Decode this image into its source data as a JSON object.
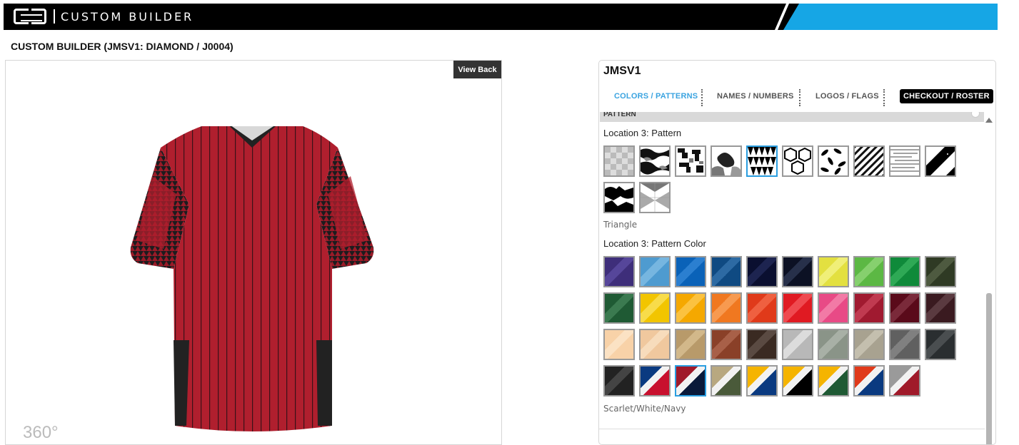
{
  "header": {
    "brand_mark": "CB",
    "brand_name": "CUSTOM BUILDER"
  },
  "page_title": "CUSTOM BUILDER (JMSV1: DIAMOND / J0004)",
  "preview": {
    "view_back_label": "View Back",
    "rotate_label": "360°"
  },
  "panel": {
    "product_code": "JMSV1",
    "tabs": [
      {
        "label": "COLORS / PATTERNS",
        "active": true
      },
      {
        "label": "NAMES / NUMBERS",
        "active": false
      },
      {
        "label": "LOGOS / FLAGS",
        "active": false
      },
      {
        "label": "CHECKOUT / ROSTER",
        "active": false
      }
    ],
    "section_header": "PATTERN",
    "pattern_label": "Location 3: Pattern",
    "patterns": [
      {
        "name": "checker",
        "selected": false
      },
      {
        "name": "camo",
        "selected": false
      },
      {
        "name": "digital-camo",
        "selected": false
      },
      {
        "name": "splatter",
        "selected": false
      },
      {
        "name": "triangle",
        "selected": true
      },
      {
        "name": "hexagon",
        "selected": false
      },
      {
        "name": "leaves",
        "selected": false
      },
      {
        "name": "diagonal-stripes",
        "selected": false
      },
      {
        "name": "horizontal-lines",
        "selected": false
      },
      {
        "name": "slash",
        "selected": false
      },
      {
        "name": "grunge",
        "selected": false
      },
      {
        "name": "diamond-fade",
        "selected": false
      }
    ],
    "selected_pattern_name": "Triangle",
    "pattern_color_label": "Location 3: Pattern Color",
    "colors": [
      {
        "c1": "#3e2e7a",
        "c2": "#56469a"
      },
      {
        "c1": "#4e9bd0",
        "c2": "#76b6e0"
      },
      {
        "c1": "#0a62b8",
        "c2": "#2b7fd0"
      },
      {
        "c1": "#0f4a82",
        "c2": "#2d6aa3"
      },
      {
        "c1": "#0a0f30",
        "c2": "#1d2450"
      },
      {
        "c1": "#0c1124",
        "c2": "#27304a"
      },
      {
        "c1": "#e3e040",
        "c2": "#f0ef78"
      },
      {
        "c1": "#5cb844",
        "c2": "#86d06e"
      },
      {
        "c1": "#0f8a3a",
        "c2": "#2ea955"
      },
      {
        "c1": "#2f3a24",
        "c2": "#4e5a40"
      },
      {
        "c1": "#1f5a34",
        "c2": "#3b7a50"
      },
      {
        "c1": "#f2c500",
        "c2": "#f8dc4a"
      },
      {
        "c1": "#f5a800",
        "c2": "#fbc240"
      },
      {
        "c1": "#f07820",
        "c2": "#f79a50"
      },
      {
        "c1": "#e03a1a",
        "c2": "#ef6040"
      },
      {
        "c1": "#e01a22",
        "c2": "#ef4a50"
      },
      {
        "c1": "#e84a86",
        "c2": "#f27aa6"
      },
      {
        "c1": "#a01a30",
        "c2": "#c03a50"
      },
      {
        "c1": "#5a0a1a",
        "c2": "#7a2a3a"
      },
      {
        "c1": "#3a1a20",
        "c2": "#5a3a40"
      },
      {
        "c1": "#f8d2a8",
        "c2": "#fbe2c4"
      },
      {
        "c1": "#f0c89e",
        "c2": "#f7dcbc"
      },
      {
        "c1": "#b89a6a",
        "c2": "#d2b88a"
      },
      {
        "c1": "#8a4028",
        "c2": "#a86048"
      },
      {
        "c1": "#3a2a22",
        "c2": "#5a4a42"
      },
      {
        "c1": "#b8b8b8",
        "c2": "#dcdcdc"
      },
      {
        "c1": "#8a9488",
        "c2": "#a8b0a6"
      },
      {
        "c1": "#a8a290",
        "c2": "#c4bfae"
      },
      {
        "c1": "#606060",
        "c2": "#808080"
      },
      {
        "c1": "#2a2e30",
        "c2": "#4a4e50"
      },
      {
        "c1": "#222222",
        "c2": "#444444"
      },
      {
        "c1": "#c8102e",
        "c2": "#0a3a80",
        "tri": true
      },
      {
        "c1": "#0a1a3a",
        "c2": "#a01a2a",
        "tri": true,
        "sel": true
      },
      {
        "c1": "#4a5a3a",
        "c2": "#b8a880",
        "tri": true
      },
      {
        "c1": "#0a3a80",
        "c2": "#f5b400",
        "tri": true
      },
      {
        "c1": "#000000",
        "c2": "#f5b400",
        "tri": true
      },
      {
        "c1": "#1f5a34",
        "c2": "#f5b400",
        "tri": true
      },
      {
        "c1": "#0a3a80",
        "c2": "#e03a1a",
        "tri": true
      },
      {
        "c1": "#a01a2a",
        "c2": "#9a9a9a",
        "tri": true
      }
    ],
    "selected_color_name": "Scarlet/White/Navy"
  }
}
